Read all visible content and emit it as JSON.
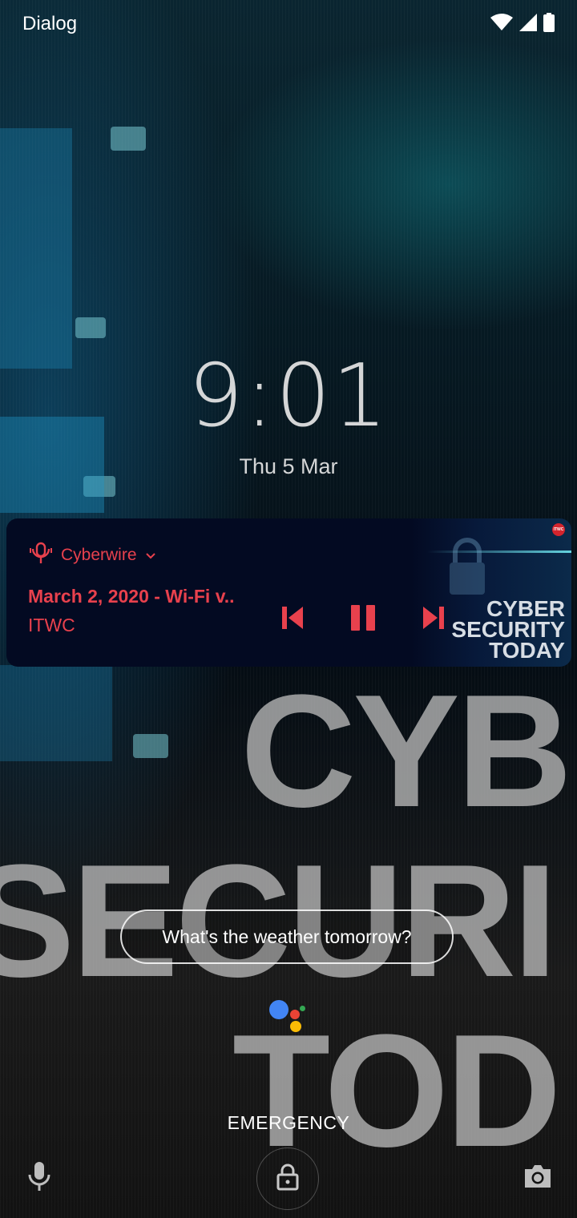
{
  "status_bar": {
    "carrier": "Dialog",
    "icons": [
      "wifi-icon",
      "cellular-signal-icon",
      "battery-icon"
    ]
  },
  "lockscreen": {
    "time": "9:01",
    "date": "Thu 5 Mar"
  },
  "media_notification": {
    "app_name": "Cyberwire",
    "app_icon": "podcast-icon",
    "title": "March 2, 2020 - Wi-Fi v..",
    "artist": "ITWC",
    "controls": [
      "previous-icon",
      "pause-icon",
      "next-icon"
    ],
    "artwork_text": [
      "CYBER",
      "SECURITY",
      "TODAY"
    ],
    "artwork_badge": "ITWC",
    "accent_color": "#e8414d"
  },
  "wallpaper": {
    "words": [
      "CYB",
      "SECURI",
      "TOD"
    ]
  },
  "assistant": {
    "suggestion": "What's the weather tomorrow?",
    "dot_colors": [
      "#4285f4",
      "#ea4335",
      "#fbbc05",
      "#34a853"
    ]
  },
  "bottom": {
    "emergency_label": "EMERGENCY",
    "left_icon": "microphone-icon",
    "center_icon": "lock-icon",
    "right_icon": "camera-icon"
  }
}
